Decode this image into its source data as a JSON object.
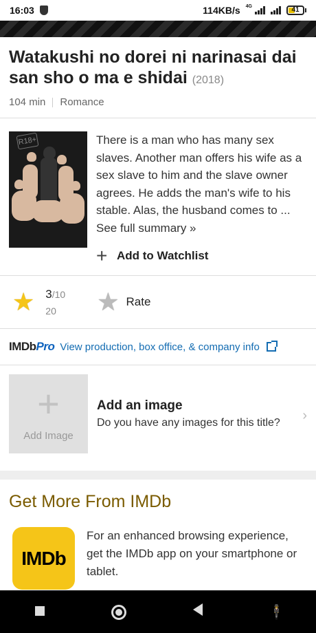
{
  "status": {
    "time": "16:03",
    "speed": "114KB/s",
    "network": "4G",
    "battery": "41"
  },
  "movie": {
    "title": "Watakushi no dorei ni narinasai dai san sho o ma e shidai",
    "year": "(2018)",
    "runtime": "104 min",
    "genre": "Romance",
    "poster_badge": "R18+",
    "summary": "There is a man who has many sex slaves. Another man offers his wife as a sex slave to him and the slave owner agrees. He adds the man's wife to his stable. Alas, the husband comes to ...",
    "see_full": "See full summary »",
    "watchlist_label": "Add to Watchlist"
  },
  "rating": {
    "score": "3",
    "out_of": "/10",
    "count": "20",
    "rate_label": "Rate"
  },
  "imdbpro": {
    "logo_imdb": "IMDb",
    "logo_pro": "Pro",
    "link_text": "View production, box office, & company info"
  },
  "add_image": {
    "box_label": "Add Image",
    "title": "Add an image",
    "subtitle": "Do you have any images for this title?"
  },
  "more": {
    "title": "Get More From IMDb",
    "app_icon_text": "IMDb",
    "app_text": "For an enhanced browsing experience, get the IMDb app on your smartphone or tablet."
  },
  "icons": {
    "star_filled": "star-icon",
    "star_outline": "star-outline-icon",
    "plus": "plus-icon",
    "external": "external-link-icon"
  },
  "colors": {
    "imdb_yellow": "#f5c518",
    "link_blue": "#136cb2",
    "pro_blue": "#0e63be",
    "heading_brown": "#7a5b00"
  }
}
